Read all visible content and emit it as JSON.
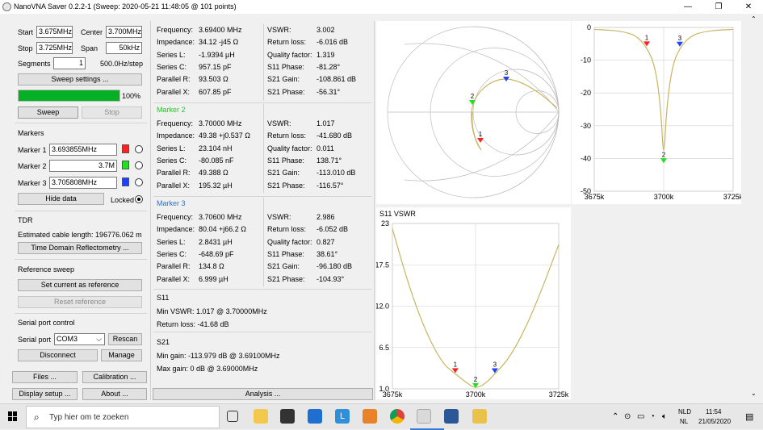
{
  "window": {
    "title": "NanoVNA Saver 0.2.2-1 (Sweep: 2020-05-21 11:48:05 @ 101 points)",
    "minimize": "—",
    "maximize": "❐",
    "close": "✕"
  },
  "sweep": {
    "start_label": "Start",
    "start_value": "3.675MHz",
    "center_label": "Center",
    "center_value": "3.700MHz",
    "stop_label": "Stop",
    "stop_value": "3.725MHz",
    "span_label": "Span",
    "span_value": "50kHz",
    "segments_label": "Segments",
    "segments_value": "1",
    "step_text": "500.0Hz/step",
    "settings_button": "Sweep settings ...",
    "progress_percent": 100,
    "progress_text": "100%",
    "sweep_button": "Sweep",
    "stop_button": "Stop"
  },
  "markers": {
    "heading": "Markers",
    "items": [
      {
        "label": "Marker 1",
        "value": "3.693855MHz",
        "color": "#ff2020"
      },
      {
        "label": "Marker 2",
        "value": "3.7M",
        "color": "#20e020"
      },
      {
        "label": "Marker 3",
        "value": "3.705808MHz",
        "color": "#2040ff"
      }
    ],
    "hide_button": "Hide data",
    "locked_label": "Locked"
  },
  "tdr": {
    "heading": "TDR",
    "cable_text": "Estimated cable length: 196776.062 m",
    "button": "Time Domain Reflectometry ..."
  },
  "reference": {
    "heading": "Reference sweep",
    "set_button": "Set current as reference",
    "reset_button": "Reset reference"
  },
  "serial": {
    "heading": "Serial port control",
    "port_label": "Serial port",
    "port_value": "COM3",
    "rescan_button": "Rescan",
    "disconnect_button": "Disconnect",
    "manage_button": "Manage"
  },
  "bottom_buttons": {
    "files": "Files ...",
    "calibration": "Calibration ...",
    "display": "Display setup ...",
    "about": "About ...",
    "analysis": "Analysis ..."
  },
  "marker_data": {
    "m1": {
      "title": "",
      "left": [
        [
          "Frequency:",
          "3.69400 MHz"
        ],
        [
          "Impedance:",
          "34.12 -j45 Ω"
        ],
        [
          "Series L:",
          "-1.9394 µH"
        ],
        [
          "Series C:",
          "957.15 pF"
        ],
        [
          "Parallel R:",
          "93.503 Ω"
        ],
        [
          "Parallel X:",
          "607.85 pF"
        ]
      ],
      "right": [
        [
          "VSWR:",
          "3.002"
        ],
        [
          "Return loss:",
          "-6.016 dB"
        ],
        [
          "Quality factor:",
          "1.319"
        ],
        [
          "S11 Phase:",
          "-81.28°"
        ],
        [
          "S21 Gain:",
          "-108.861 dB"
        ],
        [
          "S21 Phase:",
          "-56.31°"
        ]
      ]
    },
    "m2": {
      "title": "Marker 2",
      "left": [
        [
          "Frequency:",
          "3.70000 MHz"
        ],
        [
          "Impedance:",
          "49.38 +j0.537 Ω"
        ],
        [
          "Series L:",
          "23.104 nH"
        ],
        [
          "Series C:",
          "-80.085 nF"
        ],
        [
          "Parallel R:",
          "49.388 Ω"
        ],
        [
          "Parallel X:",
          "195.32 µH"
        ]
      ],
      "right": [
        [
          "VSWR:",
          "1.017"
        ],
        [
          "Return loss:",
          "-41.680 dB"
        ],
        [
          "Quality factor:",
          "0.011"
        ],
        [
          "S11 Phase:",
          "138.71°"
        ],
        [
          "S21 Gain:",
          "-113.010 dB"
        ],
        [
          "S21 Phase:",
          "-116.57°"
        ]
      ]
    },
    "m3": {
      "title": "Marker 3",
      "left": [
        [
          "Frequency:",
          "3.70600 MHz"
        ],
        [
          "Impedance:",
          "80.04 +j66.2 Ω"
        ],
        [
          "Series L:",
          "2.8431 µH"
        ],
        [
          "Series C:",
          "-648.69 pF"
        ],
        [
          "Parallel R:",
          "134.8 Ω"
        ],
        [
          "Parallel X:",
          "6.999 µH"
        ]
      ],
      "right": [
        [
          "VSWR:",
          "2.986"
        ],
        [
          "Return loss:",
          "-6.052 dB"
        ],
        [
          "Quality factor:",
          "0.827"
        ],
        [
          "S11 Phase:",
          "38.61°"
        ],
        [
          "S21 Gain:",
          "-96.180 dB"
        ],
        [
          "S21 Phase:",
          "-104.93°"
        ]
      ]
    }
  },
  "s11_summary": {
    "title": "S11",
    "min_vswr": "Min VSWR:  1.017 @ 3.70000MHz",
    "return_loss": "Return loss:  -41.68 dB"
  },
  "s21_summary": {
    "title": "S21",
    "min_gain": "Min gain:  -113.979 dB @ 3.69100MHz",
    "max_gain": "Max gain:  0 dB @ 3.69000MHz"
  },
  "chart_data": [
    {
      "type": "line",
      "title": "",
      "x_tick_labels": [
        "3675k",
        "3700k",
        "3725k"
      ],
      "y_tick_labels": [
        "0",
        "-10",
        "-20",
        "-30",
        "-40",
        "-50"
      ],
      "ylim": [
        -50,
        0
      ],
      "xlim": [
        3675,
        3725
      ],
      "series": [
        {
          "x": [
            3675,
            3680,
            3685,
            3690,
            3693.9,
            3697,
            3699,
            3700,
            3701,
            3703,
            3705.8,
            3710,
            3715,
            3720,
            3725
          ],
          "y": [
            -0.6,
            -0.8,
            -1.2,
            -2.4,
            -6.0,
            -12,
            -25,
            -41.7,
            -25,
            -12,
            -6.1,
            -2.4,
            -1.2,
            -0.8,
            -0.6
          ]
        }
      ],
      "markers": [
        {
          "label": "1",
          "x": 3693.9,
          "y": -6.0
        },
        {
          "label": "2",
          "x": 3700,
          "y": -41.7
        },
        {
          "label": "3",
          "x": 3705.8,
          "y": -6.1
        }
      ]
    },
    {
      "type": "line",
      "title": "S11 VSWR",
      "x_tick_labels": [
        "3675k",
        "3700k",
        "3725k"
      ],
      "y_tick_labels": [
        "23",
        "17.5",
        "12.0",
        "6.5",
        "1.0"
      ],
      "ylim": [
        1,
        23
      ],
      "xlim": [
        3675,
        3725
      ],
      "series": [
        {
          "x": [
            3675,
            3680,
            3685,
            3690,
            3693.9,
            3697,
            3700,
            3703,
            3705.8,
            3710,
            3715,
            3720,
            3725
          ],
          "y": [
            22.3,
            14.6,
            8.6,
            4.4,
            3.0,
            1.9,
            1.02,
            1.7,
            2.99,
            5.0,
            9.0,
            14.3,
            20.2
          ]
        }
      ],
      "markers": [
        {
          "label": "1",
          "x": 3693.9,
          "y": 3.0
        },
        {
          "label": "2",
          "x": 3700,
          "y": 1.02
        },
        {
          "label": "3",
          "x": 3705.8,
          "y": 2.99
        }
      ]
    }
  ],
  "smith_markers": [
    "1",
    "2",
    "3"
  ],
  "taskbar": {
    "search_placeholder": "Typ hier om te zoeken",
    "lang_top": "NLD",
    "lang_bottom": "NL",
    "time": "11:54",
    "date": "21/05/2020",
    "icons": [
      "task-view-icon",
      "file-explorer-icon",
      "store-icon",
      "mail-icon",
      "app-l-icon",
      "app-orange-icon",
      "chrome-icon",
      "nanovna-icon",
      "word-icon",
      "app-blue-icon"
    ]
  },
  "colors": {
    "trace": "#c8b560",
    "progress": "#06b025",
    "marker_blue": "#2e6ec4"
  }
}
